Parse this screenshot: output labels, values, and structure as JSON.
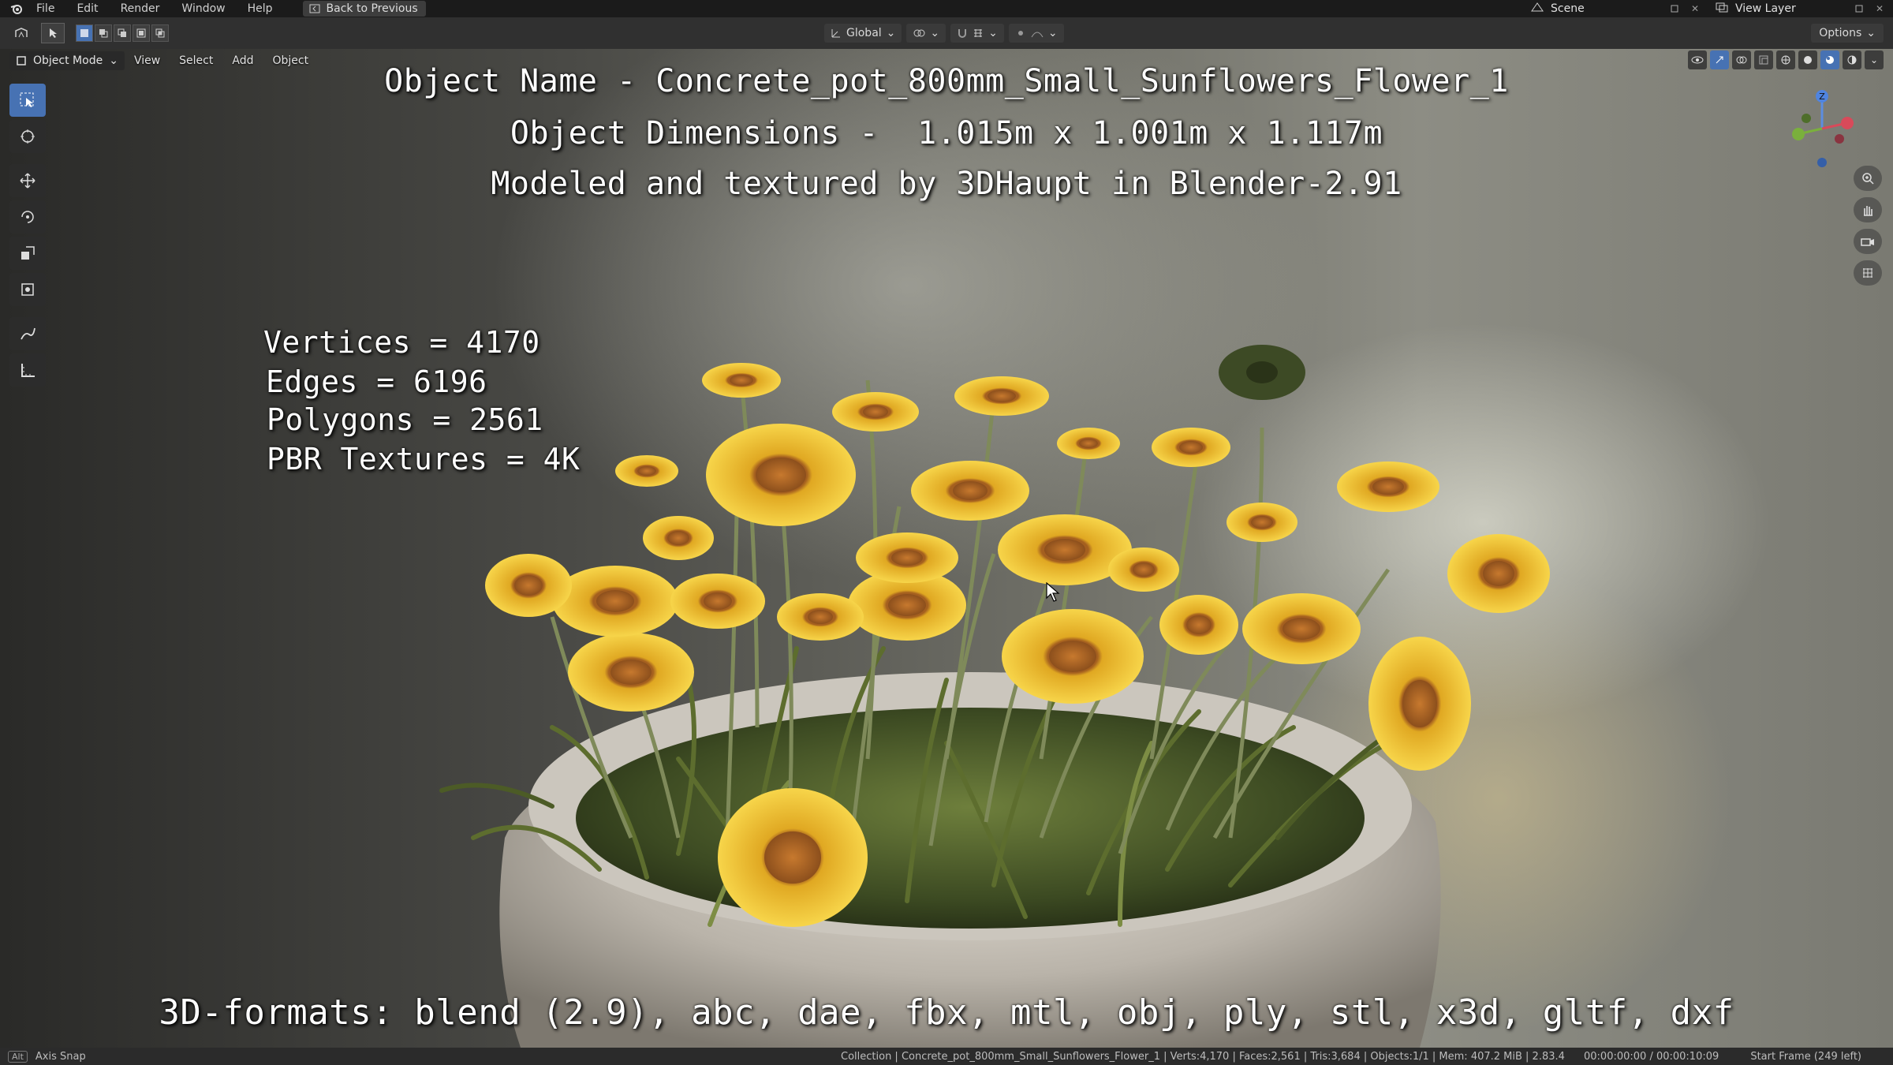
{
  "topbar": {
    "menus": [
      "File",
      "Edit",
      "Render",
      "Window",
      "Help"
    ],
    "back_label": "Back to Previous",
    "scene_label": "Scene",
    "view_layer_label": "View Layer"
  },
  "header": {
    "orientation": "Global",
    "options_label": "Options"
  },
  "viewport_header": {
    "mode": "Object Mode",
    "menus": [
      "View",
      "Select",
      "Add",
      "Object"
    ]
  },
  "overlay": {
    "title_line1": "Object Name - Concrete_pot_800mm_Small_Sunflowers_Flower_1",
    "title_line2": "Object Dimensions -  1.015m x 1.001m x 1.117m",
    "title_line3": "Modeled and textured by 3DHaupt in Blender-2.91",
    "vertices": "Vertices = 4170",
    "edges": "Edges = 6196",
    "polygons": "Polygons = 2561",
    "textures": "PBR Textures = 4K",
    "formats": "3D-formats: blend (2.9), abc, dae, fbx, mtl, obj, ply, stl, x3d, gltf, dxf"
  },
  "gizmo": {
    "z_label": "Z"
  },
  "statusbar": {
    "alt_key": "Alt",
    "axis_snap": "Axis Snap",
    "info": "Collection | Concrete_pot_800mm_Small_Sunflowers_Flower_1 | Verts:4,170 | Faces:2,561 | Tris:3,684 | Objects:1/1 | Mem: 407.2 MiB | 2.83.4",
    "time": "00:00:00:00 / 00:00:10:09",
    "frame": "Start Frame (249 left)"
  },
  "colors": {
    "accent": "#4772b3",
    "petal": "#f2c21b",
    "flower_center": "#b8702a",
    "stem": "#6c7a4a",
    "pot": "#bdb7ae"
  }
}
